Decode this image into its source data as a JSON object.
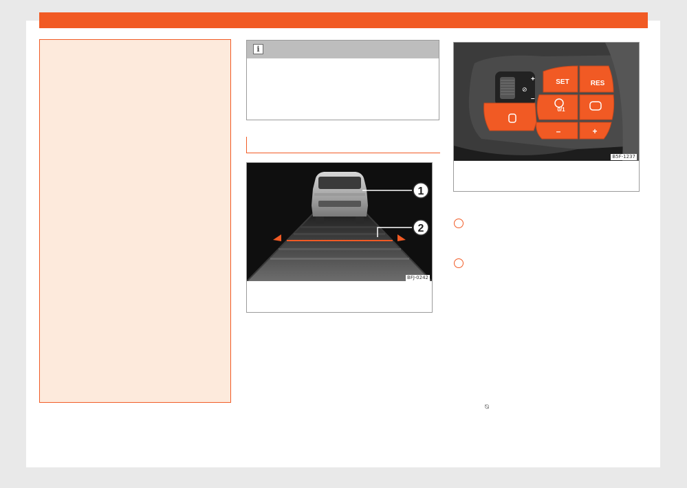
{
  "page": {
    "accent_color": "#f15a24",
    "warning_bg": "#fdeadc"
  },
  "note": {
    "icon": "info-icon",
    "icon_glyph": "i"
  },
  "figure_distance": {
    "callouts": [
      "1",
      "2"
    ],
    "code": "BFJ-0242"
  },
  "figure_buttons": {
    "code": "B5F-1237",
    "buttons": {
      "set": "SET",
      "res": "RES",
      "minus": "–",
      "plus": "+",
      "toggle": "0/1",
      "vol_plus": "+",
      "vol_minus": "–"
    }
  },
  "list": {
    "bullet_icons": [
      "circle-bullet",
      "circle-bullet"
    ]
  },
  "inline_icon": {
    "name": "cruise-control-icon",
    "glyph": "⍉"
  }
}
